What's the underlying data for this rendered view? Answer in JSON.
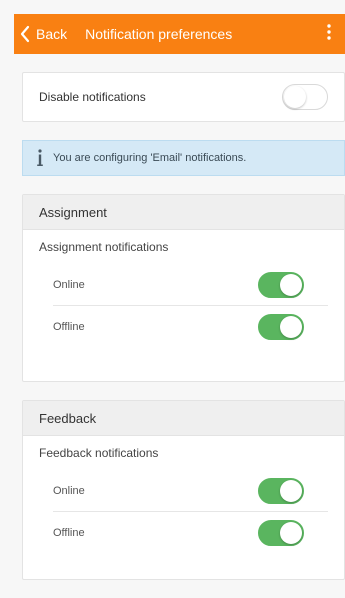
{
  "header": {
    "back_label": "Back",
    "title": "Notification preferences",
    "color": "#f98012"
  },
  "disable": {
    "label": "Disable notifications",
    "enabled": false
  },
  "info": {
    "text": "You are configuring 'Email' notifications."
  },
  "sections": [
    {
      "title": "Assignment",
      "subtitle": "Assignment notifications",
      "options": [
        {
          "label": "Online",
          "on": true
        },
        {
          "label": "Offline",
          "on": true
        }
      ]
    },
    {
      "title": "Feedback",
      "subtitle": "Feedback notifications",
      "options": [
        {
          "label": "Online",
          "on": true
        },
        {
          "label": "Offline",
          "on": true
        }
      ]
    }
  ],
  "colors": {
    "toggle_on": "#5ab55f",
    "info_bg": "#d5e9f6"
  },
  "icons": {
    "back": "chevron-left-icon",
    "menu": "kebab-menu-icon",
    "info": "info-icon"
  }
}
